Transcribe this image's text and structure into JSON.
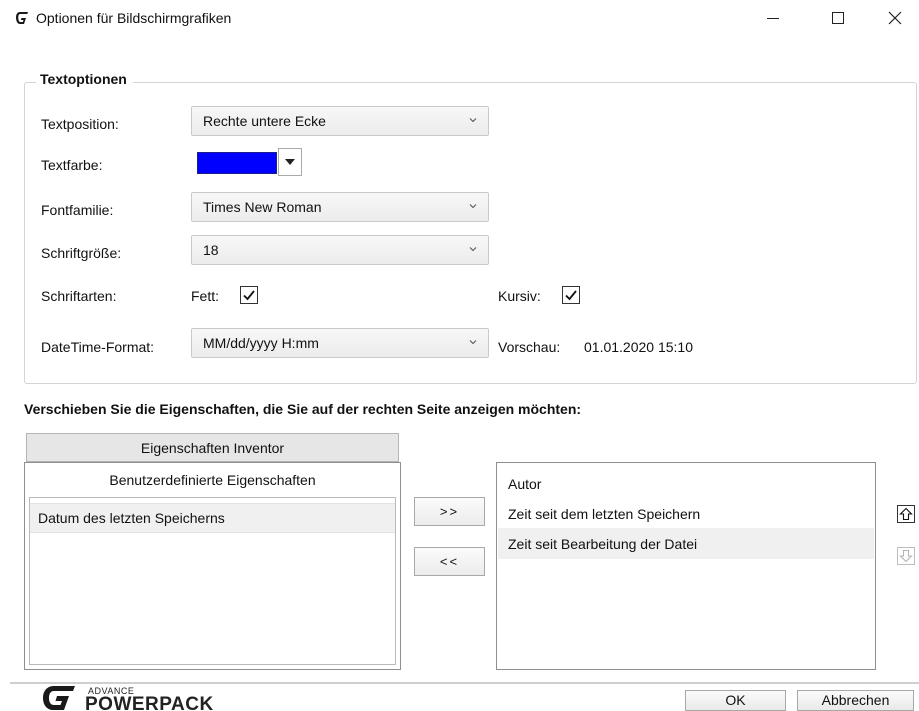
{
  "window": {
    "title": "Optionen für Bildschirmgrafiken",
    "minimize_glyph": "—",
    "maximize_glyph": "☐",
    "close_glyph": "✕"
  },
  "text_options": {
    "legend": "Textoptionen",
    "position_label": "Textposition:",
    "position_value": "Rechte untere Ecke",
    "color_label": "Textfarbe:",
    "color_value": "#0000ff",
    "font_family_label": "Fontfamilie:",
    "font_family_value": "Times New Roman",
    "font_size_label": "Schriftgröße:",
    "font_size_value": "18",
    "styles_label": "Schriftarten:",
    "bold_label": "Fett:",
    "bold_checked": true,
    "italic_label": "Kursiv:",
    "italic_checked": true,
    "datetime_label": "DateTime-Format:",
    "datetime_value": "MM/dd/yyyy H:mm",
    "preview_label": "Vorschau:",
    "preview_value": "01.01.2020 15:10"
  },
  "properties": {
    "instruction": "Verschieben Sie die Eigenschaften, die Sie auf der rechten Seite anzeigen möchten:",
    "tab_label": "Eigenschaften Inventor",
    "left_header": "Benutzerdefinierte Eigenschaften",
    "left_items": [
      {
        "label": "Datum des letzten Speicherns",
        "selected": true
      }
    ],
    "move_right_label": ">>",
    "move_left_label": "<<",
    "right_items": [
      {
        "label": "Autor",
        "selected": false
      },
      {
        "label": "Zeit seit dem letzten Speichern",
        "selected": false
      },
      {
        "label": "Zeit seit Bearbeitung der Datei",
        "selected": true
      }
    ]
  },
  "footer": {
    "logo_small": "ADVANCE",
    "logo_big": "POWERPACK",
    "ok_label": "OK",
    "cancel_label": "Abbrechen"
  },
  "colors": {
    "brand": "#1a1a1a",
    "accent_blue": "#0000ff"
  }
}
